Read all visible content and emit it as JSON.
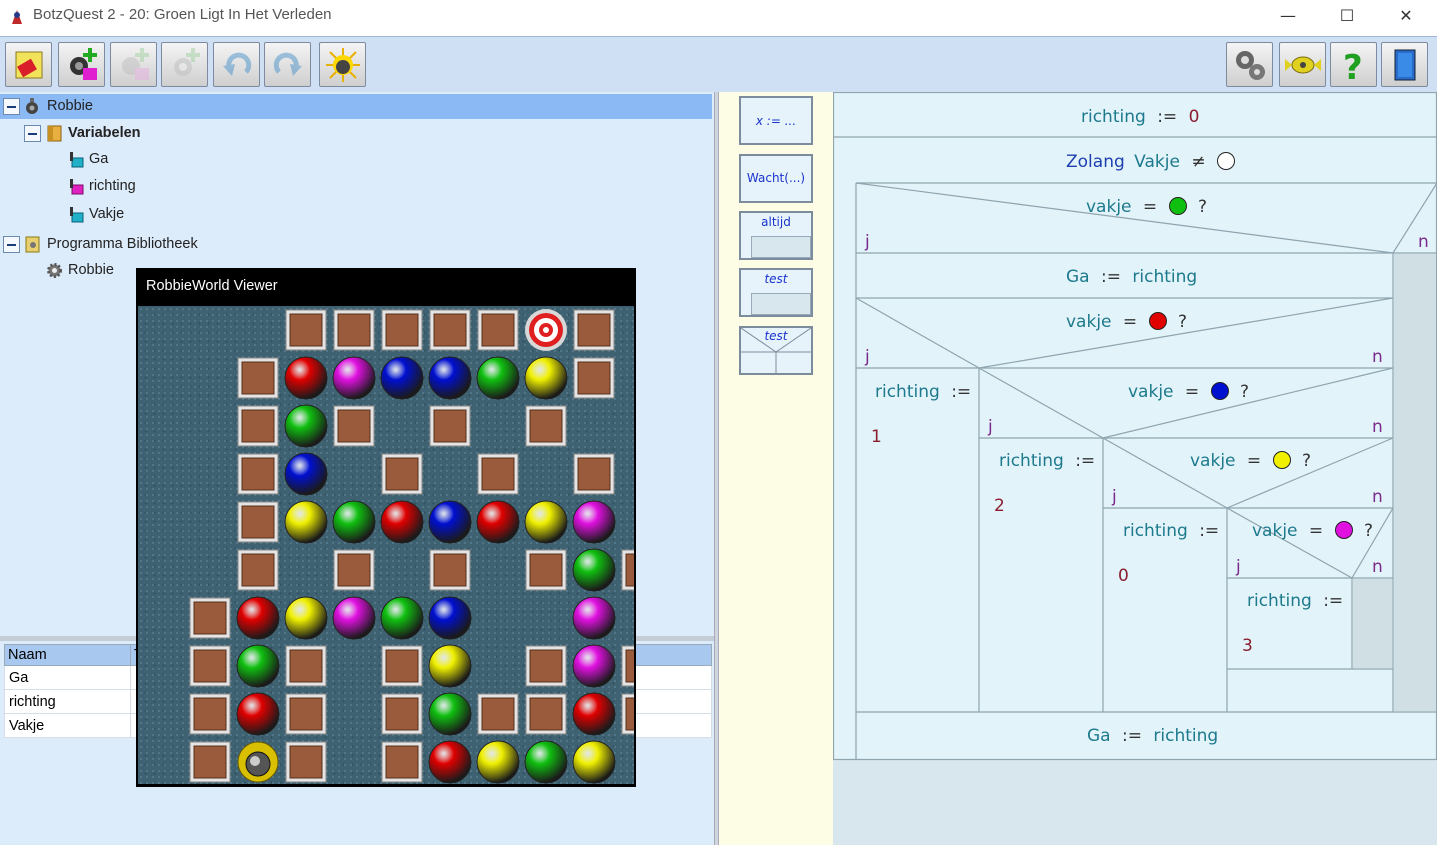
{
  "window": {
    "title": "BotzQuest 2 - 20: Groen Ligt In Het Verleden",
    "min": "—",
    "max": "☐",
    "close": "✕"
  },
  "tree": {
    "robot": "Robbie",
    "vars_folder": "Variabelen",
    "vars": [
      "Ga",
      "richting",
      "Vakje"
    ],
    "library": "Programma Bibliotheek",
    "library_item": "Robbie"
  },
  "grid": {
    "col_name": "Naam",
    "col_type": "T",
    "rows": [
      "Ga",
      "richting",
      "Vakje"
    ]
  },
  "viewer": {
    "title": "RobbieWorld Viewer",
    "board": [
      "...WWWWWTW..",
      "..WRMBBGYW..",
      "..WGW.W.W...",
      "..WB.W.W.W..",
      "..WYGRBRYM..",
      "..W.W.W.WGW.",
      ".WRYMGB..M..",
      ".WGW.WY.WMW.",
      ".WRW.WGWWRW.",
      ".WKW.WRYGY.."
    ]
  },
  "palette": {
    "assign": "x := ...",
    "wait": "Wacht(...)",
    "always": "altijd",
    "test": "test",
    "test2": "test"
  },
  "nsd": {
    "assign_top": {
      "var": "richting",
      "op": ":=",
      "val": "0"
    },
    "while": {
      "kw": "Zolang",
      "var": "Vakje",
      "op": "≠"
    },
    "cond1": {
      "var": "vakje",
      "op": "=",
      "q": "?"
    },
    "ga_assign": {
      "var": "Ga",
      "op": ":=",
      "val": "richting"
    },
    "cond2": {
      "var": "vakje",
      "op": "=",
      "q": "?"
    },
    "cond3": {
      "var": "vakje",
      "op": "=",
      "q": "?"
    },
    "cond4": {
      "var": "vakje",
      "op": "=",
      "q": "?"
    },
    "cond5": {
      "var": "vakje",
      "op": "=",
      "q": "?"
    },
    "set1": {
      "var": "richting",
      "op": ":=",
      "val": "1"
    },
    "set2": {
      "var": "richting",
      "op": ":=",
      "val": "2"
    },
    "set3": {
      "var": "richting",
      "op": ":=",
      "val": "0"
    },
    "set4": {
      "var": "richting",
      "op": ":=",
      "val": "3"
    },
    "ga_bottom": {
      "var": "Ga",
      "op": ":=",
      "val": "richting"
    },
    "yes": "j",
    "no": "n"
  },
  "colors": {
    "green": "#10c010",
    "red": "#e00000",
    "blue": "#0010d0",
    "yellow": "#f0f000",
    "magenta": "#e010e0",
    "white": "#ffffff"
  }
}
